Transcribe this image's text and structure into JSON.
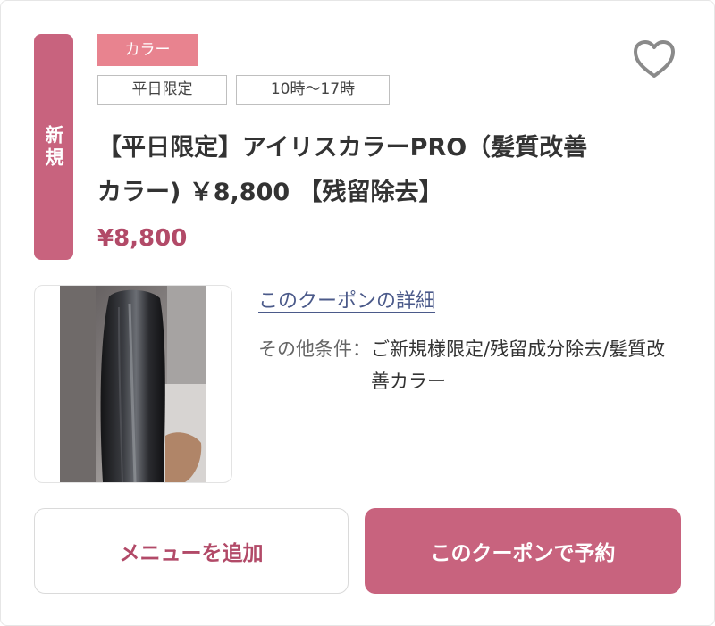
{
  "coupon": {
    "new_badge": "新規",
    "category_tag": "カラー",
    "conditions_tags": [
      "平日限定",
      "10時〜17時"
    ],
    "title": "【平日限定】アイリスカラーPRO（髪質改善カラー) ￥8,800 【残留除去】",
    "price": "¥8,800",
    "detail_link": "このクーポンの詳細",
    "other_conditions_label": "その他条件：",
    "other_conditions_value": "ご新規様限定/残留成分除去/髪質改善カラー",
    "favorite_icon": "heart-outline-icon"
  },
  "actions": {
    "add_menu_label": "メニューを追加",
    "reserve_label": "このクーポンで予約"
  },
  "colors": {
    "accent": "#c8637e",
    "category_tag": "#e8838f",
    "price": "#b24a68",
    "link": "#4b5a8a"
  }
}
